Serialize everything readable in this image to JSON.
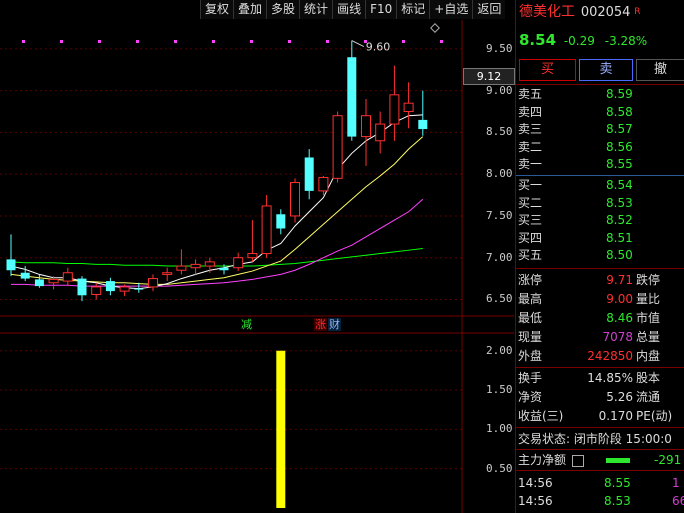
{
  "toolbar": [
    "复权",
    "叠加",
    "多股",
    "统计",
    "画线",
    "F10",
    "标记",
    "+自选",
    "返回"
  ],
  "stock": {
    "name": "德美化工",
    "code": "002054",
    "badge": "R",
    "price": "8.54",
    "change": "-0.29",
    "change_pct": "-3.28%"
  },
  "trade_buttons": {
    "buy": "买",
    "sell": "卖",
    "cancel": "撤"
  },
  "price_axis": [
    "9.50",
    "9.00",
    "8.50",
    "8.00",
    "7.50",
    "7.00",
    "6.50"
  ],
  "current_price_tag": "9.12",
  "high_marker": "9.60",
  "event_labels": {
    "reduce": "减",
    "rise": "涨",
    "finance": "财"
  },
  "volume_axis": [
    "2.00",
    "1.50",
    "1.00",
    "0.50"
  ],
  "order_book": {
    "asks": [
      {
        "label": "卖五",
        "price": "8.59"
      },
      {
        "label": "卖四",
        "price": "8.58"
      },
      {
        "label": "卖三",
        "price": "8.57"
      },
      {
        "label": "卖二",
        "price": "8.56"
      },
      {
        "label": "卖一",
        "price": "8.55"
      }
    ],
    "bids": [
      {
        "label": "买一",
        "price": "8.54"
      },
      {
        "label": "买二",
        "price": "8.53"
      },
      {
        "label": "买三",
        "price": "8.52"
      },
      {
        "label": "买四",
        "price": "8.51"
      },
      {
        "label": "买五",
        "price": "8.50"
      }
    ]
  },
  "stats": [
    {
      "label": "涨停",
      "value": "9.71",
      "side": "跌停",
      "color": "red"
    },
    {
      "label": "最高",
      "value": "9.00",
      "side": "量比",
      "color": "red"
    },
    {
      "label": "最低",
      "value": "8.46",
      "side": "市值",
      "color": "green"
    },
    {
      "label": "现量",
      "value": "7078",
      "side": "总量",
      "color": "purple"
    },
    {
      "label": "外盘",
      "value": "242850",
      "side": "内盘",
      "color": "red"
    }
  ],
  "stats2": [
    {
      "label": "换手",
      "value": "14.85%",
      "side": "股本"
    },
    {
      "label": "净资",
      "value": "5.26",
      "side": "流通"
    },
    {
      "label": "收益(三)",
      "value": "0.170",
      "side": "PE(动)"
    }
  ],
  "trade_status": "交易状态: 闭市阶段 15:00:0",
  "main_flow": {
    "label": "主力净额",
    "value": "-291"
  },
  "ticks": [
    {
      "time": "14:56",
      "price": "8.55",
      "vol": "1"
    },
    {
      "time": "14:56",
      "price": "8.53",
      "vol": "66"
    }
  ],
  "chart_data": {
    "type": "candlestick",
    "ylim": [
      6.35,
      9.75
    ],
    "candles": [
      {
        "o": 6.98,
        "h": 7.28,
        "l": 6.78,
        "c": 6.85
      },
      {
        "o": 6.82,
        "h": 6.9,
        "l": 6.72,
        "c": 6.75
      },
      {
        "o": 6.74,
        "h": 6.8,
        "l": 6.64,
        "c": 6.66
      },
      {
        "o": 6.7,
        "h": 6.78,
        "l": 6.62,
        "c": 6.74
      },
      {
        "o": 6.72,
        "h": 6.88,
        "l": 6.66,
        "c": 6.82
      },
      {
        "o": 6.75,
        "h": 6.78,
        "l": 6.48,
        "c": 6.55
      },
      {
        "o": 6.56,
        "h": 6.7,
        "l": 6.5,
        "c": 6.65
      },
      {
        "o": 6.72,
        "h": 6.76,
        "l": 6.55,
        "c": 6.6
      },
      {
        "o": 6.6,
        "h": 6.68,
        "l": 6.54,
        "c": 6.65
      },
      {
        "o": 6.63,
        "h": 6.7,
        "l": 6.58,
        "c": 6.62
      },
      {
        "o": 6.65,
        "h": 6.8,
        "l": 6.6,
        "c": 6.75
      },
      {
        "o": 6.8,
        "h": 6.88,
        "l": 6.72,
        "c": 6.82
      },
      {
        "o": 6.85,
        "h": 7.1,
        "l": 6.8,
        "c": 6.9
      },
      {
        "o": 6.88,
        "h": 6.98,
        "l": 6.8,
        "c": 6.92
      },
      {
        "o": 6.9,
        "h": 7.0,
        "l": 6.82,
        "c": 6.95
      },
      {
        "o": 6.88,
        "h": 6.92,
        "l": 6.8,
        "c": 6.85
      },
      {
        "o": 6.88,
        "h": 7.06,
        "l": 6.84,
        "c": 7.0
      },
      {
        "o": 7.0,
        "h": 7.45,
        "l": 6.95,
        "c": 7.05
      },
      {
        "o": 7.05,
        "h": 7.75,
        "l": 7.0,
        "c": 7.62
      },
      {
        "o": 7.52,
        "h": 7.58,
        "l": 7.28,
        "c": 7.35
      },
      {
        "o": 7.5,
        "h": 7.95,
        "l": 7.42,
        "c": 7.9
      },
      {
        "o": 8.2,
        "h": 8.3,
        "l": 7.7,
        "c": 7.8
      },
      {
        "o": 7.8,
        "h": 7.98,
        "l": 7.75,
        "c": 7.96
      },
      {
        "o": 7.95,
        "h": 8.75,
        "l": 7.9,
        "c": 8.7
      },
      {
        "o": 9.4,
        "h": 9.6,
        "l": 8.4,
        "c": 8.45
      },
      {
        "o": 8.45,
        "h": 8.9,
        "l": 8.1,
        "c": 8.7
      },
      {
        "o": 8.4,
        "h": 8.75,
        "l": 8.25,
        "c": 8.6
      },
      {
        "o": 8.6,
        "h": 9.3,
        "l": 8.4,
        "c": 8.95
      },
      {
        "o": 8.75,
        "h": 9.1,
        "l": 8.55,
        "c": 8.85
      },
      {
        "o": 8.65,
        "h": 9.0,
        "l": 8.46,
        "c": 8.54
      }
    ],
    "ma5": [
      6.9,
      6.86,
      6.8,
      6.76,
      6.76,
      6.72,
      6.7,
      6.66,
      6.64,
      6.63,
      6.65,
      6.69,
      6.75,
      6.8,
      6.85,
      6.88,
      6.92,
      6.95,
      7.09,
      7.17,
      7.38,
      7.55,
      7.72,
      8.06,
      8.25,
      8.4,
      8.5,
      8.62,
      8.7,
      8.71
    ],
    "ma10": [
      6.8,
      6.78,
      6.76,
      6.74,
      6.73,
      6.72,
      6.71,
      6.7,
      6.7,
      6.69,
      6.68,
      6.68,
      6.7,
      6.72,
      6.74,
      6.76,
      6.8,
      6.84,
      6.9,
      6.96,
      7.1,
      7.25,
      7.4,
      7.55,
      7.7,
      7.85,
      7.98,
      8.12,
      8.3,
      8.45
    ],
    "ma20": [
      6.68,
      6.68,
      6.67,
      6.67,
      6.67,
      6.66,
      6.66,
      6.66,
      6.66,
      6.66,
      6.66,
      6.66,
      6.67,
      6.68,
      6.69,
      6.7,
      6.72,
      6.74,
      6.77,
      6.8,
      6.85,
      6.92,
      7.0,
      7.08,
      7.15,
      7.25,
      7.35,
      7.45,
      7.55,
      7.7
    ],
    "ma60": [
      6.95,
      6.94,
      6.94,
      6.94,
      6.93,
      6.93,
      6.92,
      6.92,
      6.91,
      6.91,
      6.91,
      6.9,
      6.9,
      6.9,
      6.9,
      6.9,
      6.9,
      6.9,
      6.91,
      6.92,
      6.93,
      6.95,
      6.97,
      6.99,
      7.01,
      7.03,
      7.05,
      7.07,
      7.09,
      7.11
    ],
    "volume_bar": {
      "index": 19,
      "value": 2.0
    },
    "volume_ylim": [
      0,
      2.2
    ]
  },
  "colors": {
    "up": "#ff3030",
    "down": "#54ffff",
    "ma5": "#ffffff",
    "ma10": "#ffff66",
    "ma20": "#ff40ff",
    "ma60": "#00ff00",
    "vol": "#ffff00"
  }
}
